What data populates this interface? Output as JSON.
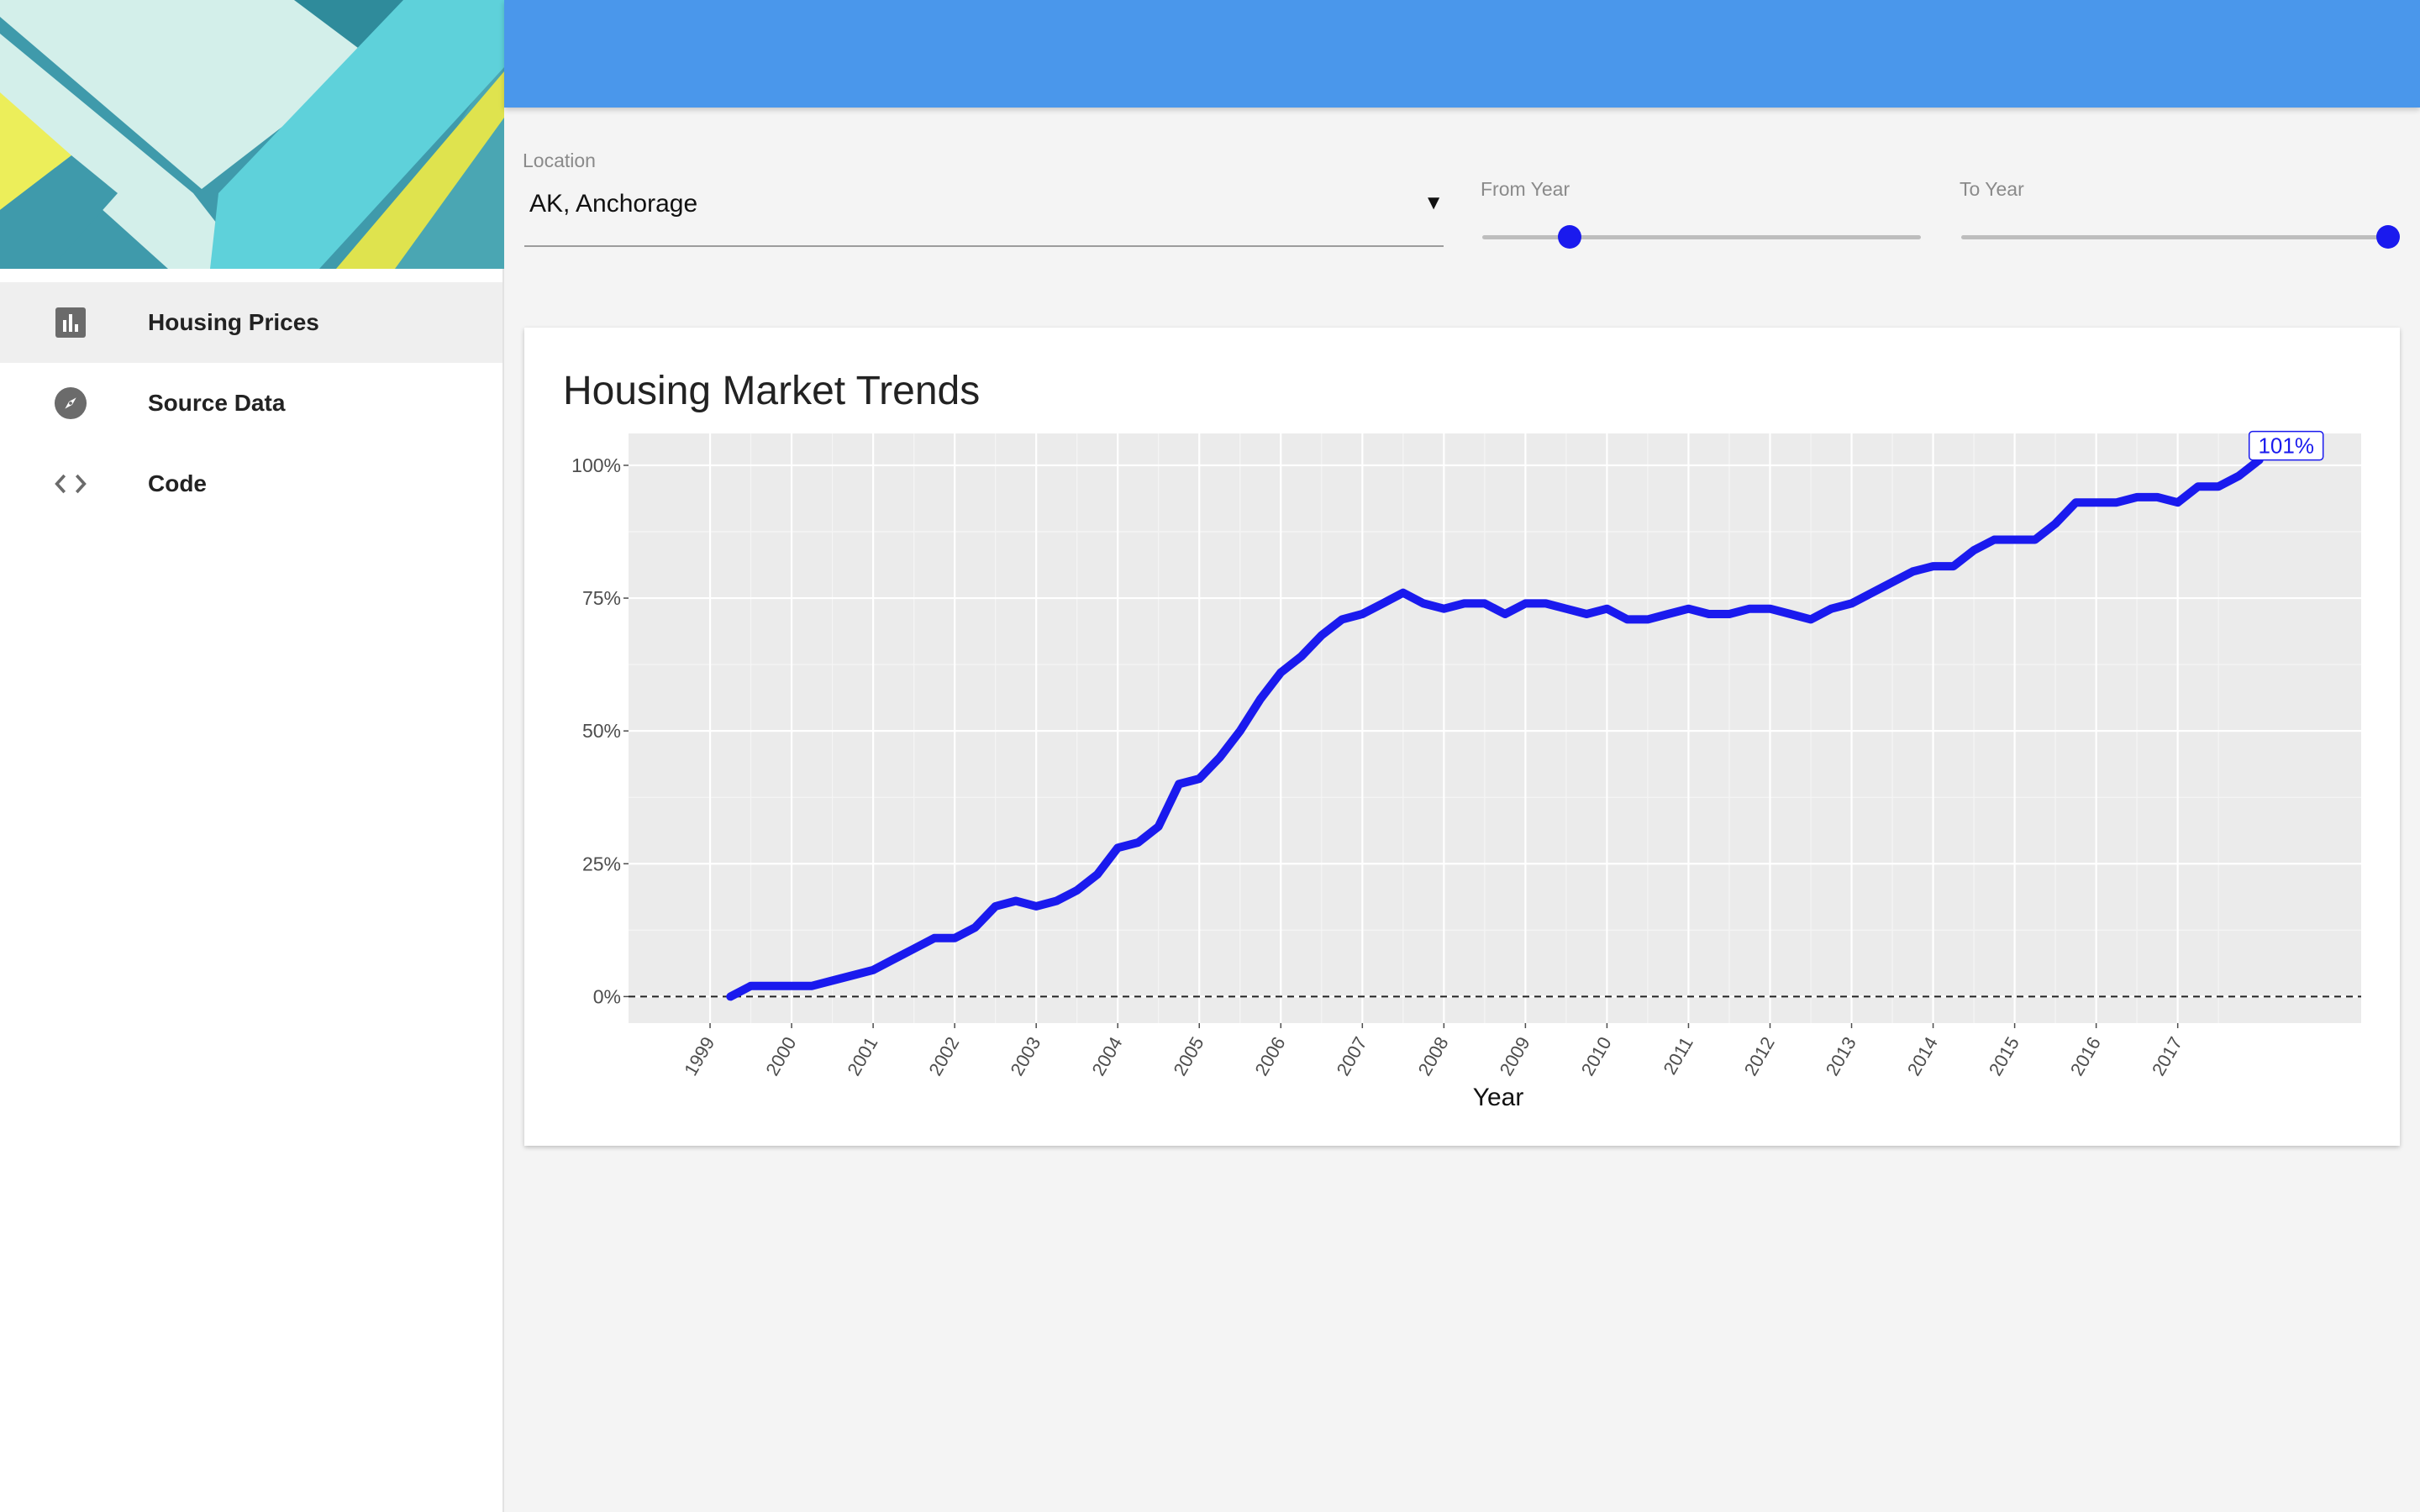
{
  "sidebar": {
    "items": [
      {
        "label": "Housing Prices",
        "icon": "bar-chart-icon",
        "active": true
      },
      {
        "label": "Source Data",
        "icon": "compass-icon",
        "active": false
      },
      {
        "label": "Code",
        "icon": "code-icon",
        "active": false
      }
    ]
  },
  "controls": {
    "location": {
      "label": "Location",
      "value": "AK, Anchorage"
    },
    "from_year": {
      "label": "From Year",
      "value": 0.2
    },
    "to_year": {
      "label": "To Year",
      "value": 1.0
    }
  },
  "colors": {
    "header": "#4a97eb",
    "line": "#1a1aee",
    "panel": "#ebebeb"
  },
  "chart_data": {
    "type": "line",
    "title": "Housing Market Trends",
    "xlabel": "Year",
    "ylabel": "",
    "xlim": [
      1998.0,
      2019.25
    ],
    "ylim": [
      -0.05,
      1.06
    ],
    "y_ticks": [
      0,
      0.25,
      0.5,
      0.75,
      1.0
    ],
    "y_tick_labels": [
      "0%",
      "25%",
      "50%",
      "75%",
      "100%"
    ],
    "x_ticks": [
      1999,
      2000,
      2001,
      2002,
      2003,
      2004,
      2005,
      2006,
      2007,
      2008,
      2009,
      2010,
      2011,
      2012,
      2013,
      2014,
      2015,
      2016,
      2017
    ],
    "x_tick_labels": [
      "1999",
      "2000",
      "2001",
      "2002",
      "2003",
      "2004",
      "2005",
      "2006",
      "2007",
      "2008",
      "2009",
      "2010",
      "2011",
      "2012",
      "2013",
      "2014",
      "2015",
      "2016",
      "2017"
    ],
    "grid": true,
    "reference_line": {
      "y": 0,
      "style": "dashed"
    },
    "end_label": "101%",
    "series": [
      {
        "x": [
          1999.25,
          1999.5,
          1999.75,
          2000.0,
          2000.25,
          2000.5,
          2000.75,
          2001.0,
          2001.25,
          2001.5,
          2001.75,
          2002.0,
          2002.25,
          2002.5,
          2002.75,
          2003.0,
          2003.25,
          2003.5,
          2003.75,
          2004.0,
          2004.25,
          2004.5,
          2004.75,
          2005.0,
          2005.25,
          2005.5,
          2005.75,
          2006.0,
          2006.25,
          2006.5,
          2006.75,
          2007.0,
          2007.25,
          2007.5,
          2007.75,
          2008.0,
          2008.25,
          2008.5,
          2008.75,
          2009.0,
          2009.25,
          2009.5,
          2009.75,
          2010.0,
          2010.25,
          2010.5,
          2010.75,
          2011.0,
          2011.25,
          2011.5,
          2011.75,
          2012.0,
          2012.25,
          2012.5,
          2012.75,
          2013.0,
          2013.25,
          2013.5,
          2013.75,
          2014.0,
          2014.25,
          2014.5,
          2014.75,
          2015.0,
          2015.25,
          2015.5,
          2015.75,
          2016.0,
          2016.25,
          2016.5,
          2016.75,
          2017.0,
          2017.25,
          2017.5,
          2017.75,
          2018.0
        ],
        "values": [
          0.0,
          0.02,
          0.02,
          0.02,
          0.02,
          0.03,
          0.04,
          0.05,
          0.07,
          0.09,
          0.11,
          0.11,
          0.13,
          0.17,
          0.18,
          0.17,
          0.18,
          0.2,
          0.23,
          0.28,
          0.29,
          0.32,
          0.4,
          0.41,
          0.45,
          0.5,
          0.56,
          0.61,
          0.64,
          0.68,
          0.71,
          0.72,
          0.74,
          0.76,
          0.74,
          0.73,
          0.74,
          0.74,
          0.72,
          0.74,
          0.74,
          0.73,
          0.72,
          0.73,
          0.71,
          0.71,
          0.72,
          0.73,
          0.72,
          0.72,
          0.73,
          0.73,
          0.72,
          0.71,
          0.73,
          0.74,
          0.76,
          0.78,
          0.8,
          0.81,
          0.81,
          0.84,
          0.86,
          0.86,
          0.86,
          0.89,
          0.93,
          0.93,
          0.93,
          0.94,
          0.94,
          0.93,
          0.96,
          0.96,
          0.98,
          1.01
        ]
      }
    ]
  }
}
